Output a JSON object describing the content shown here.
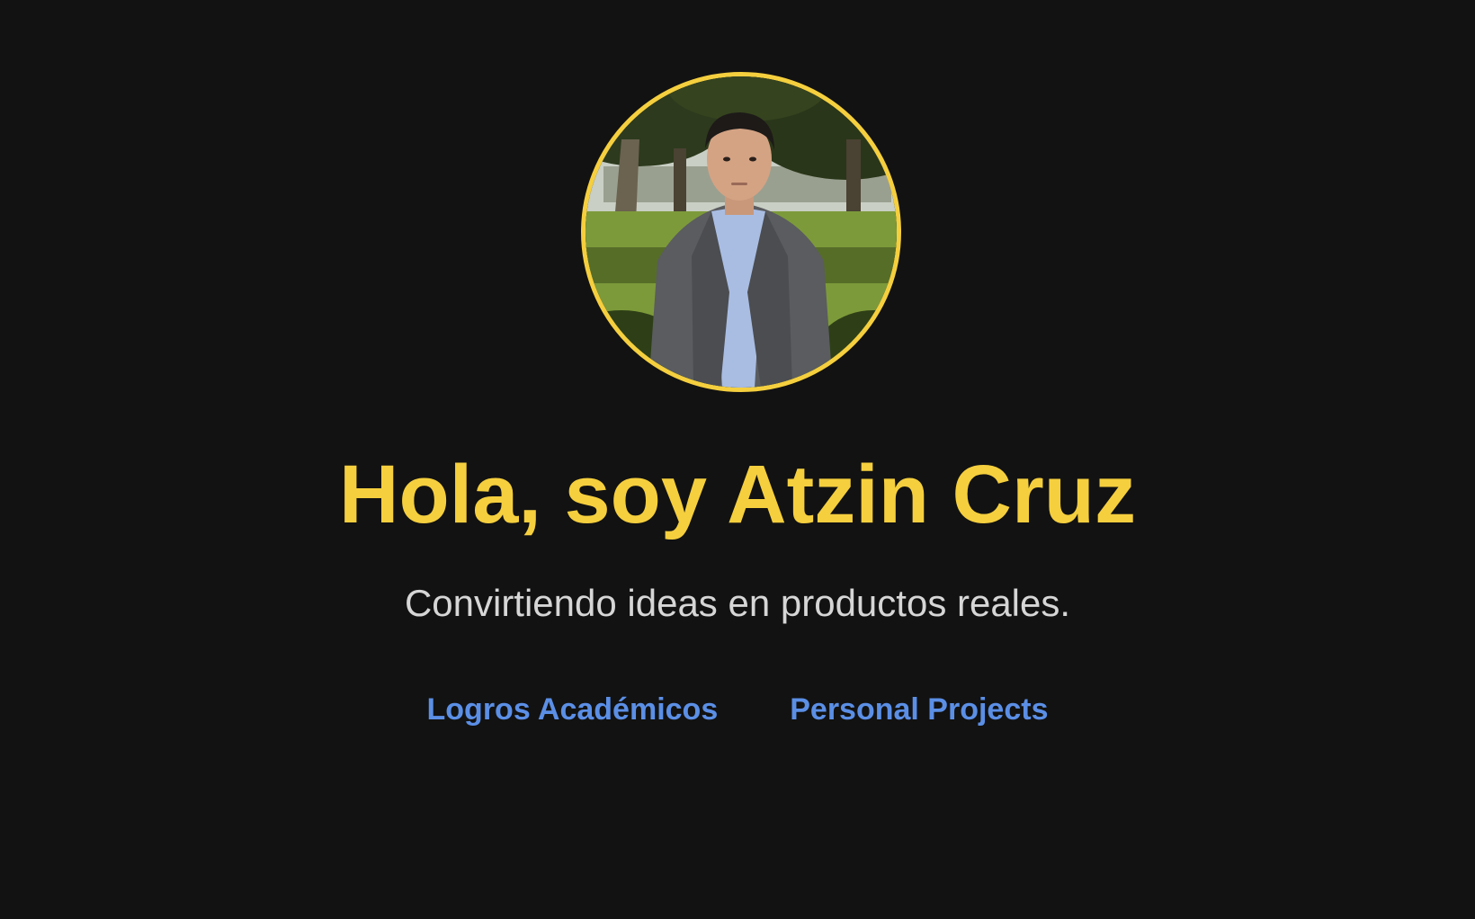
{
  "profile": {
    "photo": "profile-photo",
    "border_color": "#f5cf3e"
  },
  "hero": {
    "title": "Hola, soy Atzin Cruz",
    "subtitle": "Convirtiendo ideas en productos reales."
  },
  "nav": {
    "links": [
      {
        "label": "Logros Académicos"
      },
      {
        "label": "Personal Projects"
      }
    ]
  },
  "colors": {
    "background": "#121212",
    "accent": "#f5cf3e",
    "link": "#5b8fe6",
    "subtitle": "#d6d6d6"
  }
}
